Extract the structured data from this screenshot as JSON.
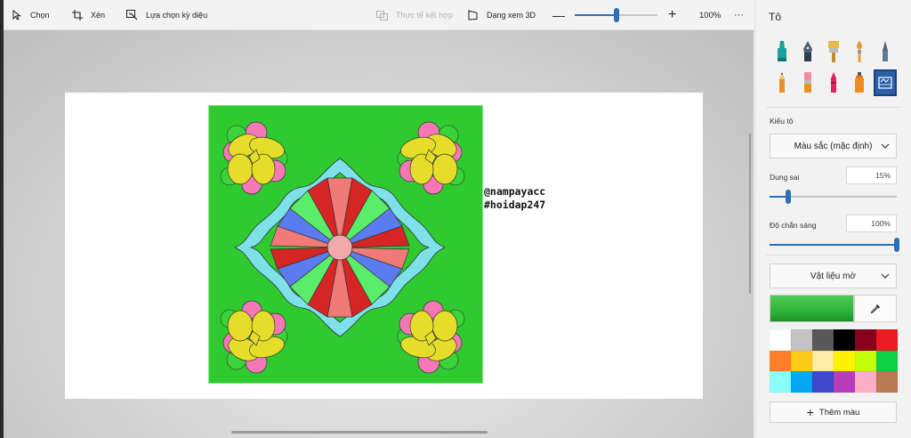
{
  "toolbar": {
    "select_label": "Chọn",
    "crop_label": "Xén",
    "magic_select_label": "Lựa chọn kỳ diệu",
    "mixed_reality_label": "Thực tế kết hợp",
    "view_3d_label": "Dạng xem 3D",
    "zoom_value": "100%",
    "zoom_level": 0.5,
    "more_label": "···"
  },
  "canvas": {
    "watermark_line1": "@nampayacc",
    "watermark_line2": "#hoidap247"
  },
  "panel": {
    "title": "Tô",
    "brushes": [
      "marker-brush-icon",
      "calligraphy-pen-icon",
      "oil-brush-icon",
      "watercolor-brush-icon",
      "pixel-pen-icon",
      "pencil-icon",
      "eraser-icon",
      "crayon-icon",
      "spray-can-icon",
      "fill-bucket-icon"
    ],
    "active_brush": "fill-bucket-icon",
    "fill_type_label": "Kiểu tô",
    "fill_type_value": "Màu sắc (mặc định)",
    "tolerance_label": "Dung sai",
    "tolerance_value": "15%",
    "tolerance_level": 0.15,
    "opacity_label": "Độ chắn sáng",
    "opacity_value": "100%",
    "opacity_level": 1.0,
    "material_value": "Vật liệu mờ",
    "current_color": "#2fb53a",
    "palette": [
      "#ffffff",
      "#c3c3c3",
      "#585858",
      "#000000",
      "#88001b",
      "#ec1c24",
      "#ff7f27",
      "#ffca18",
      "#fdeca6",
      "#fff200",
      "#c4ff0e",
      "#0ed145",
      "#8cfffb",
      "#00a8f3",
      "#3f48cc",
      "#b83dba",
      "#ffaec8",
      "#b97a56"
    ],
    "add_color_label": "Thêm màu"
  }
}
